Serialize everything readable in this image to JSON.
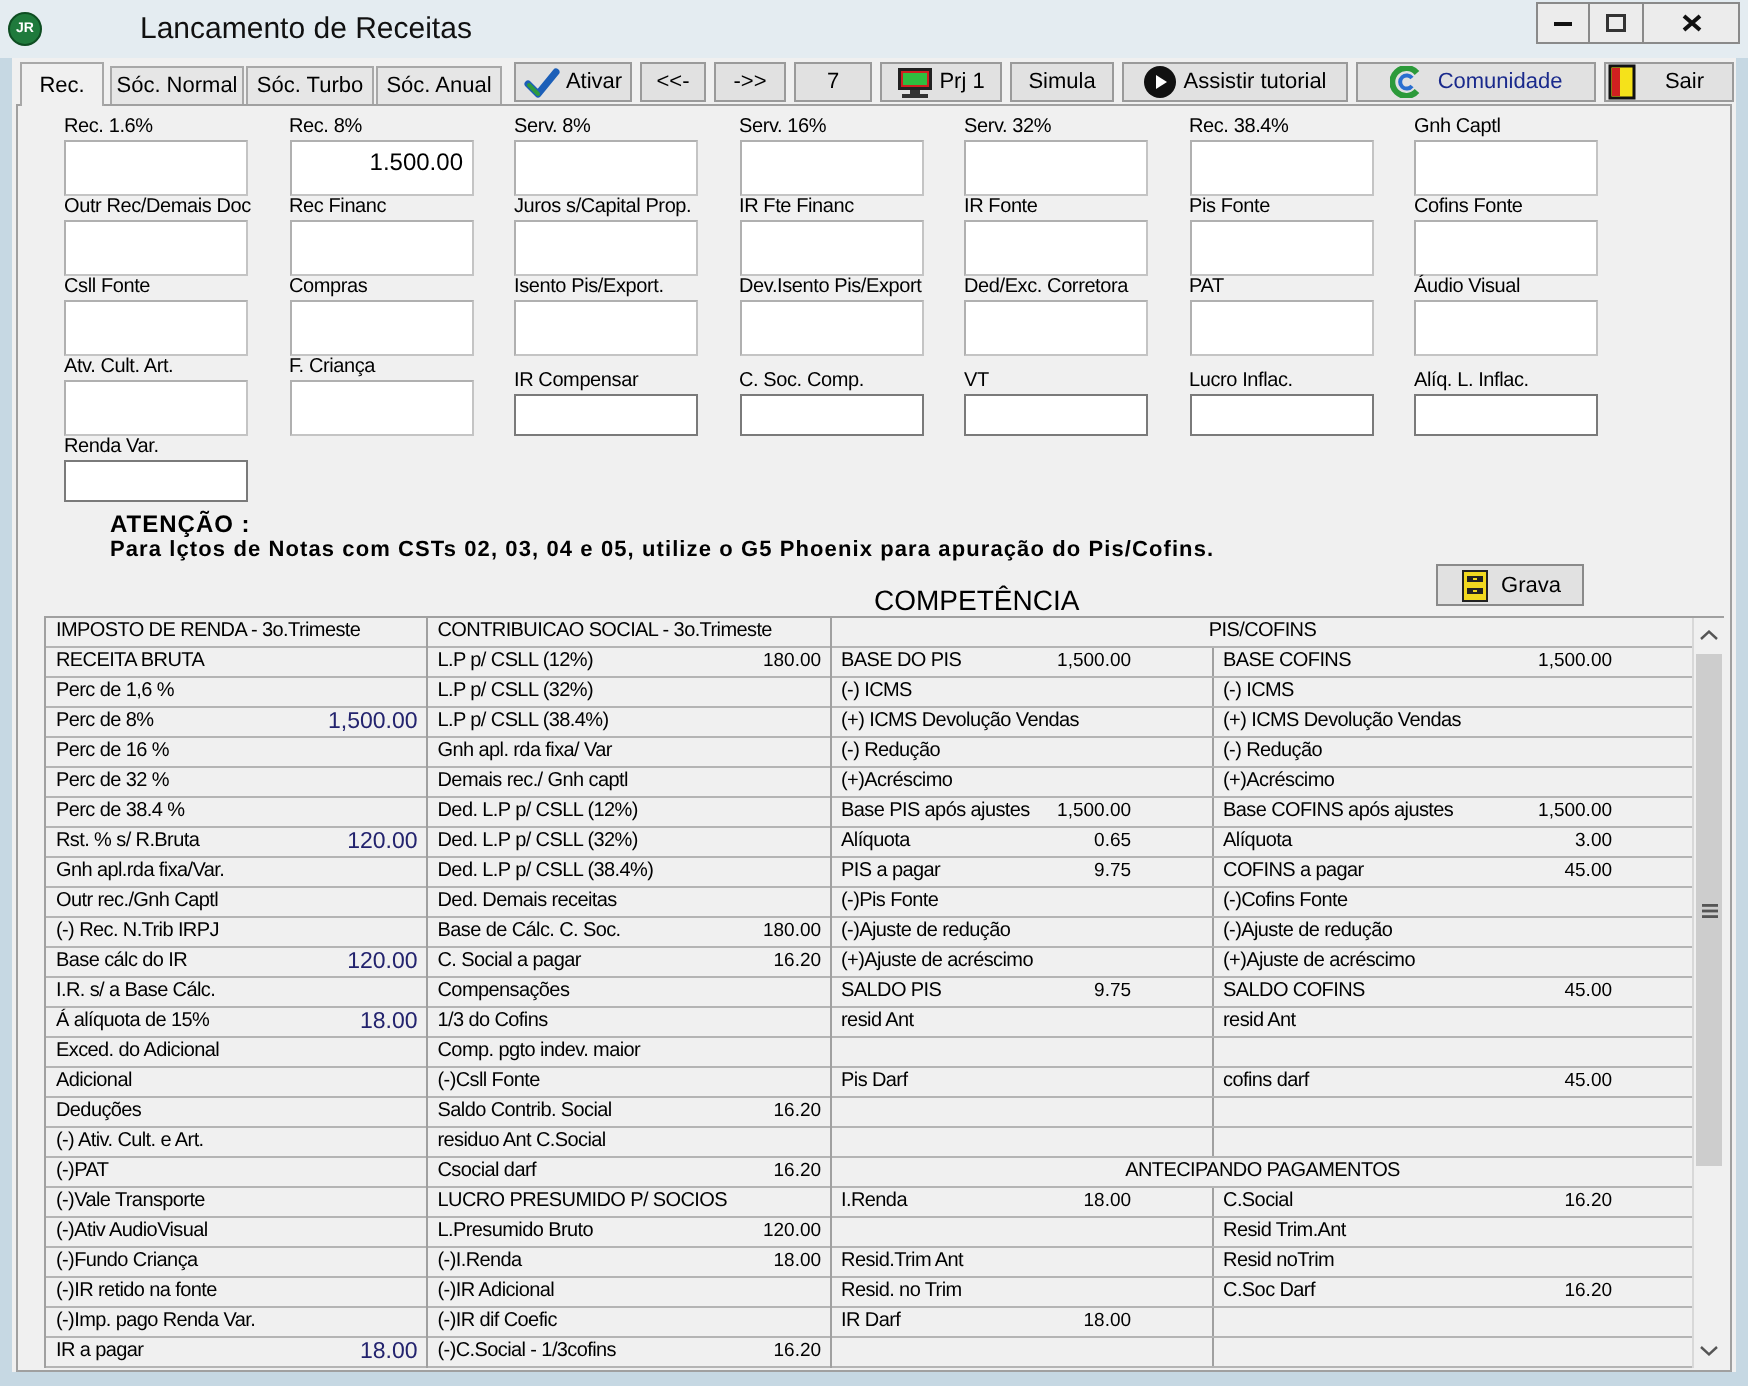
{
  "window": {
    "title": "Lancamento de Receitas",
    "logo": "JR"
  },
  "tabs": [
    {
      "label": "Rec.",
      "selected": true
    },
    {
      "label": "Sóc. Normal",
      "selected": false
    },
    {
      "label": "Sóc. Turbo",
      "selected": false
    },
    {
      "label": "Sóc. Anual",
      "selected": false
    }
  ],
  "toolbar": [
    {
      "label": "Ativar",
      "kind": "check"
    },
    {
      "label": "<<-",
      "kind": "plain"
    },
    {
      "label": "->>",
      "kind": "plain"
    },
    {
      "label": "7",
      "kind": "plain"
    },
    {
      "label": "Prj 1",
      "kind": "monitor"
    },
    {
      "label": "Simula",
      "kind": "plain"
    },
    {
      "label": "Assistir tutorial",
      "kind": "play"
    },
    {
      "label": "Comunidade",
      "kind": "ring"
    },
    {
      "label": "Sair",
      "kind": "door"
    }
  ],
  "form": {
    "rows": [
      [
        {
          "label": "Rec. 1.6%",
          "kind": "sunken"
        },
        {
          "label": "Rec. 8%",
          "kind": "sunken",
          "value": "1.500.00"
        },
        {
          "label": "Serv. 8%",
          "kind": "sunken"
        },
        {
          "label": "Serv. 16%",
          "kind": "sunken"
        },
        {
          "label": "Serv. 32%",
          "kind": "sunken"
        },
        {
          "label": "Rec. 38.4%",
          "kind": "sunken"
        },
        {
          "label": "Gnh Captl",
          "kind": "sunken"
        }
      ],
      [
        {
          "label": "Outr Rec/Demais Doc",
          "kind": "sunken"
        },
        {
          "label": "Rec Financ",
          "kind": "sunken"
        },
        {
          "label": "Juros s/Capital Prop.",
          "kind": "sunken"
        },
        {
          "label": "IR Fte Financ",
          "kind": "sunken"
        },
        {
          "label": "IR Fonte",
          "kind": "sunken"
        },
        {
          "label": "Pis Fonte",
          "kind": "sunken"
        },
        {
          "label": "Cofins Fonte",
          "kind": "sunken"
        }
      ],
      [
        {
          "label": "Csll Fonte",
          "kind": "sunken"
        },
        {
          "label": "Compras",
          "kind": "sunken"
        },
        {
          "label": "Isento Pis/Export.",
          "kind": "sunken"
        },
        {
          "label": "Dev.Isento Pis/Export",
          "kind": "sunken"
        },
        {
          "label": "Ded/Exc. Corretora",
          "kind": "sunken"
        },
        {
          "label": "PAT",
          "kind": "sunken"
        },
        {
          "label": "Áudio Visual",
          "kind": "sunken"
        }
      ],
      [
        {
          "label": "Atv. Cult. Art.",
          "kind": "sunken"
        },
        {
          "label": "F. Criança",
          "kind": "sunken"
        },
        {
          "label": "IR Compensar",
          "kind": "flat"
        },
        {
          "label": "C. Soc. Comp.",
          "kind": "flat"
        },
        {
          "label": "VT",
          "kind": "flat"
        },
        {
          "label": "Lucro Inflac.",
          "kind": "flat"
        },
        {
          "label": "Alíq. L. Inflac.",
          "kind": "flat"
        }
      ],
      [
        {
          "label": "Renda Var.",
          "kind": "flat"
        }
      ]
    ]
  },
  "notice": {
    "title": "ATENÇÃO :",
    "text": "Para lçtos de Notas com CSTs 02, 03, 04 e 05, utilize o G5 Phoenix para apuração do Pis/Cofins."
  },
  "competencia": {
    "title": "COMPETÊNCIA",
    "button": "Grava"
  },
  "income_tax": {
    "header": "IMPOSTO DE RENDA - 3o.Trimeste",
    "rows": [
      {
        "label": "RECEITA BRUTA"
      },
      {
        "label": "Perc de 1,6 %"
      },
      {
        "label": "Perc de 8%",
        "value": "1,500.00"
      },
      {
        "label": "Perc de 16 %"
      },
      {
        "label": "Perc de 32 %"
      },
      {
        "label": "Perc de 38.4 %"
      },
      {
        "label": "Rst. % s/ R.Bruta",
        "value": "120.00"
      },
      {
        "label": "Gnh apl.rda fixa/Var."
      },
      {
        "label": "Outr rec./Gnh Captl"
      },
      {
        "label": "(-) Rec. N.Trib IRPJ"
      },
      {
        "label": "Base cálc do IR",
        "value": "120.00"
      },
      {
        "label": "I.R. s/ a Base Cálc."
      },
      {
        "label": "Á alíquota de 15%",
        "value": "18.00"
      },
      {
        "label": "Exced. do Adicional"
      },
      {
        "label": "Adicional"
      },
      {
        "label": "Deduções"
      },
      {
        "label": "(-) Ativ. Cult. e Art."
      },
      {
        "label": "(-)PAT"
      },
      {
        "label": "(-)Vale Transporte"
      },
      {
        "label": "(-)Ativ AudioVisual"
      },
      {
        "label": "(-)Fundo Criança"
      },
      {
        "label": "(-)IR retido na fonte"
      },
      {
        "label": "(-)Imp. pago Renda Var."
      },
      {
        "label": "IR a pagar",
        "value": "18.00"
      }
    ]
  },
  "social_contribution": {
    "header": "CONTRIBUICAO SOCIAL - 3o.Trimeste",
    "rows": [
      {
        "label": "L.P p/ CSLL (12%)",
        "value": "180.00"
      },
      {
        "label": "L.P p/ CSLL (32%)"
      },
      {
        "label": "L.P p/ CSLL (38.4%)"
      },
      {
        "label": "Gnh apl. rda fixa/ Var"
      },
      {
        "label": "Demais rec./ Gnh captl"
      },
      {
        "label": "Ded. L.P p/ CSLL (12%)"
      },
      {
        "label": "Ded. L.P p/ CSLL (32%)"
      },
      {
        "label": "Ded. L.P p/ CSLL (38.4%)"
      },
      {
        "label": "Ded. Demais receitas"
      },
      {
        "label": "Base de Cálc. C. Soc.",
        "value": "180.00"
      },
      {
        "label": "C. Social a pagar",
        "value": "16.20"
      },
      {
        "label": "Compensações"
      },
      {
        "label": "1/3 do Cofins"
      },
      {
        "label": "Comp. pgto indev. maior"
      },
      {
        "label": "(-)Csll Fonte"
      },
      {
        "label": "Saldo Contrib. Social",
        "value": "16.20"
      },
      {
        "label": "residuo Ant C.Social"
      },
      {
        "label": "Csocial darf",
        "value": "16.20"
      },
      {
        "label": "LUCRO PRESUMIDO P/ SOCIOS"
      },
      {
        "label": "L.Presumido Bruto",
        "value": "120.00"
      },
      {
        "label": "(-)I.Renda",
        "value": "18.00"
      },
      {
        "label": "(-)IR Adicional"
      },
      {
        "label": "(-)IR dif Coefic"
      },
      {
        "label": "(-)C.Social - 1/3cofins",
        "value": "16.20"
      }
    ]
  },
  "pis_cofins": {
    "header": "PIS/COFINS",
    "rows": [
      {
        "kind": "pair",
        "left": {
          "label": "BASE DO PIS",
          "value": "1,500.00"
        },
        "right": {
          "label": "BASE COFINS",
          "value": "1,500.00"
        }
      },
      {
        "kind": "pair",
        "left": {
          "label": "(-) ICMS"
        },
        "right": {
          "label": "(-) ICMS"
        }
      },
      {
        "kind": "pair",
        "left": {
          "label": "(+) ICMS Devolução Vendas"
        },
        "right": {
          "label": "(+) ICMS Devolução Vendas"
        }
      },
      {
        "kind": "pair",
        "left": {
          "label": "(-) Redução"
        },
        "right": {
          "label": "(-) Redução"
        }
      },
      {
        "kind": "pair",
        "left": {
          "label": "(+)Acréscimo"
        },
        "right": {
          "label": "(+)Acréscimo"
        }
      },
      {
        "kind": "pair",
        "left": {
          "label": "Base PIS após ajustes",
          "value": "1,500.00"
        },
        "right": {
          "label": "Base COFINS após ajustes",
          "value": "1,500.00"
        }
      },
      {
        "kind": "pair",
        "left": {
          "label": "Alíquota",
          "value": "0.65"
        },
        "right": {
          "label": "Alíquota",
          "value": "3.00"
        }
      },
      {
        "kind": "pair",
        "left": {
          "label": "PIS a pagar",
          "value": "9.75"
        },
        "right": {
          "label": "COFINS a pagar",
          "value": "45.00"
        }
      },
      {
        "kind": "pair",
        "left": {
          "label": "(-)Pis Fonte"
        },
        "right": {
          "label": "(-)Cofins Fonte"
        }
      },
      {
        "kind": "pair",
        "left": {
          "label": "(-)Ajuste de redução"
        },
        "right": {
          "label": "(-)Ajuste de redução"
        }
      },
      {
        "kind": "pair",
        "left": {
          "label": "(+)Ajuste de acréscimo"
        },
        "right": {
          "label": "(+)Ajuste de acréscimo"
        }
      },
      {
        "kind": "pair",
        "left": {
          "label": "SALDO PIS",
          "value": "9.75"
        },
        "right": {
          "label": "SALDO COFINS",
          "value": "45.00"
        }
      },
      {
        "kind": "pair",
        "left": {
          "label": "resid Ant"
        },
        "right": {
          "label": "resid Ant"
        }
      },
      {
        "kind": "pair"
      },
      {
        "kind": "pair",
        "left": {
          "label": "Pis Darf"
        },
        "right": {
          "label": "cofins darf",
          "value": "45.00"
        }
      },
      {
        "kind": "pair"
      },
      {
        "kind": "pair"
      },
      {
        "kind": "section",
        "label": "ANTECIPANDO PAGAMENTOS"
      },
      {
        "kind": "pair",
        "left": {
          "label": "I.Renda",
          "value": "18.00"
        },
        "right": {
          "label": "C.Social",
          "value": "16.20"
        }
      },
      {
        "kind": "pair",
        "right": {
          "label": "Resid Trim.Ant"
        }
      },
      {
        "kind": "pair",
        "left": {
          "label": "Resid.Trim Ant"
        },
        "right": {
          "label": "Resid noTrim"
        }
      },
      {
        "kind": "pair",
        "left": {
          "label": "Resid. no Trim"
        },
        "right": {
          "label": "C.Soc Darf",
          "value": "16.20"
        }
      },
      {
        "kind": "pair",
        "left": {
          "label": "IR Darf",
          "value": "18.00"
        }
      },
      {
        "kind": "pair"
      }
    ]
  }
}
